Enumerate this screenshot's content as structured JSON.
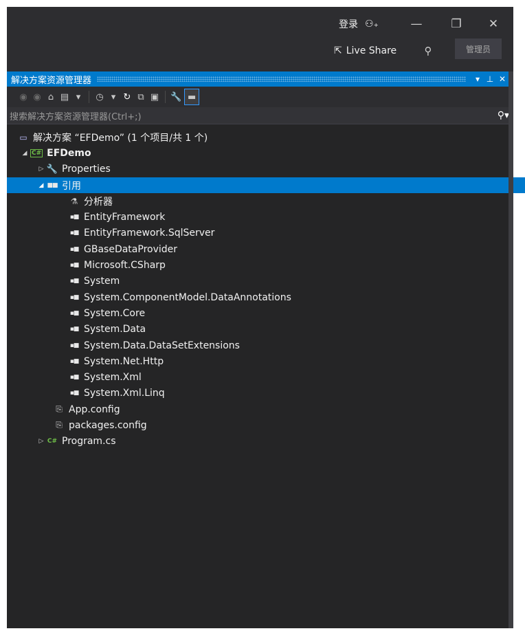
{
  "titlebar": {
    "login": "登录",
    "live_share": "Live Share",
    "admin": "管理员"
  },
  "panel": {
    "title": "解决方案资源管理器",
    "search_placeholder": "搜索解决方案资源管理器(Ctrl+;)"
  },
  "tree": {
    "solution": "解决方案 “EFDemo” (1 个项目/共 1 个)",
    "project": "EFDemo",
    "properties": "Properties",
    "references": "引用",
    "analyzers": "分析器",
    "refs": [
      "EntityFramework",
      "EntityFramework.SqlServer",
      "GBaseDataProvider",
      "Microsoft.CSharp",
      "System",
      "System.ComponentModel.DataAnnotations",
      "System.Core",
      "System.Data",
      "System.Data.DataSetExtensions",
      "System.Net.Http",
      "System.Xml",
      "System.Xml.Linq"
    ],
    "app_config": "App.config",
    "packages_config": "packages.config",
    "program": "Program.cs"
  },
  "colors": {
    "accent": "#007acc",
    "background": "#252526",
    "csharp": "#6fbf48"
  }
}
